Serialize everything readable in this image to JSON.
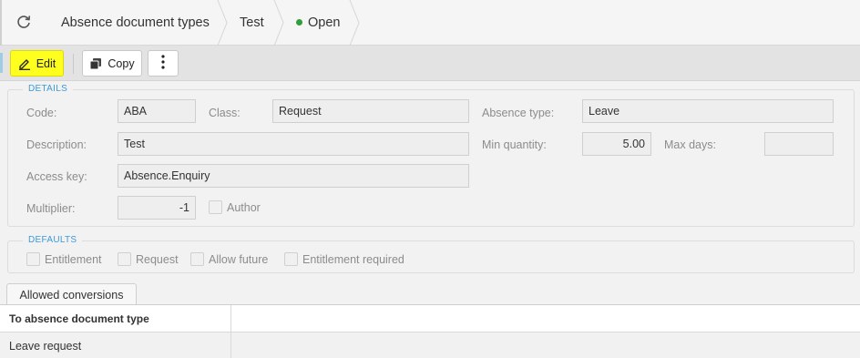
{
  "header": {
    "breadcrumbs": [
      "Absence document types",
      "Test"
    ],
    "status": "Open",
    "status_color": "#2e9e3f",
    "refresh_icon": "refresh-icon"
  },
  "toolbar": {
    "edit_label": "Edit",
    "copy_label": "Copy",
    "edit_icon": "pencil-icon",
    "copy_icon": "copy-icon",
    "more_icon": "more-vertical-icon"
  },
  "details": {
    "legend": "DETAILS",
    "code_label": "Code:",
    "code_value": "ABA",
    "class_label": "Class:",
    "class_value": "Request",
    "absence_type_label": "Absence type:",
    "absence_type_value": "Leave",
    "description_label": "Description:",
    "description_value": "Test",
    "min_quantity_label": "Min quantity:",
    "min_quantity_value": "5.00",
    "max_days_label": "Max days:",
    "max_days_value": "",
    "access_key_label": "Access key:",
    "access_key_value": "Absence.Enquiry",
    "multiplier_label": "Multiplier:",
    "multiplier_value": "-1",
    "author_label": "Author"
  },
  "defaults": {
    "legend": "DEFAULTS",
    "entitlement_label": "Entitlement",
    "request_label": "Request",
    "allow_future_label": "Allow future",
    "entitlement_required_label": "Entitlement required"
  },
  "tabs": {
    "allowed_conversions": "Allowed conversions"
  },
  "grid": {
    "columns": [
      "To absence document type"
    ],
    "rows": [
      [
        "Leave request"
      ]
    ]
  },
  "colors": {
    "accent": "#3b9ad9",
    "edit_button": "#ffff1f"
  }
}
